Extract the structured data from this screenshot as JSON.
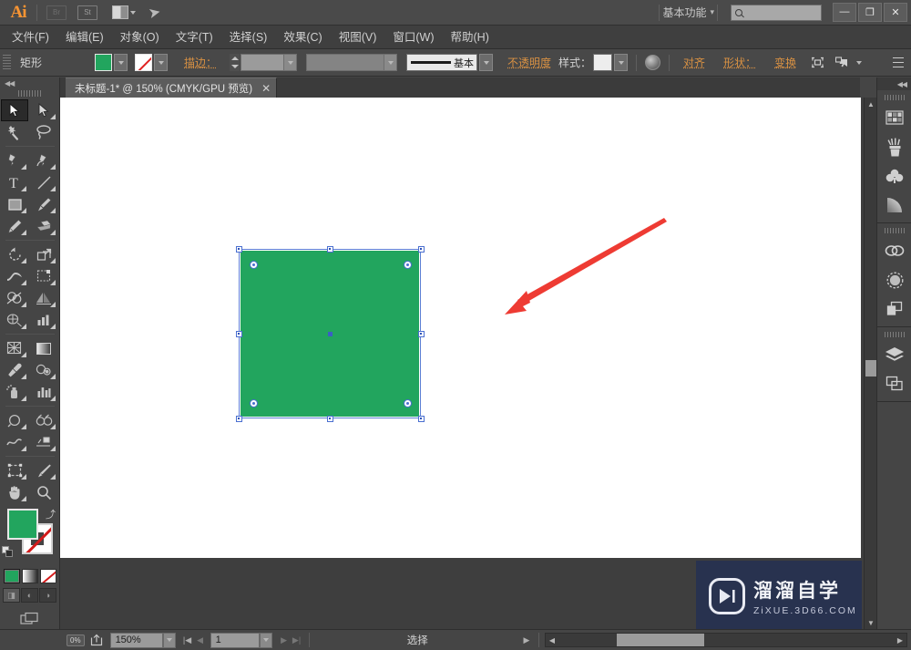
{
  "app": {
    "name": "Adobe Illustrator",
    "logo_text": "Ai",
    "bridge_label": "Br",
    "stock_label": "St"
  },
  "titlebar": {
    "workspace_label": "基本功能",
    "workspace_caret": "▾",
    "search_placeholder": "",
    "search_icon": "search-icon",
    "minimize": "—",
    "restore": "❐",
    "close": "✕"
  },
  "menubar": {
    "items": [
      {
        "label": "文件(F)"
      },
      {
        "label": "编辑(E)"
      },
      {
        "label": "对象(O)"
      },
      {
        "label": "文字(T)"
      },
      {
        "label": "选择(S)"
      },
      {
        "label": "效果(C)"
      },
      {
        "label": "视图(V)"
      },
      {
        "label": "窗口(W)"
      },
      {
        "label": "帮助(H)"
      }
    ]
  },
  "controlbar": {
    "tool_name": "矩形",
    "fill_color": "#22a55e",
    "stroke_color": "none",
    "stroke_label": "描边：",
    "stroke_weight": "",
    "stroke_variable_width": "",
    "stroke_profile_label": "基本",
    "opacity_label": "不透明度",
    "style_label": "样式：",
    "align_label": "对齐",
    "shape_label": "形状：",
    "transform_label": "变换",
    "recolor_icon": "recolor-artwork-icon",
    "isolate_icon": "isolate-selected-icon",
    "select_similar_icon": "select-similar-objects-icon",
    "panel_menu_icon": "panel-options-icon"
  },
  "tabbar": {
    "document_title": "未标题-1* @ 150% (CMYK/GPU 预览)",
    "close_label": "✕"
  },
  "toolbar": {
    "collapse_icon": "collapse-panel-icon",
    "tools": [
      {
        "name": "selection-tool",
        "label": "选择工具",
        "active": true
      },
      {
        "name": "direct-selection-tool",
        "label": "直接选择工具",
        "active": false
      },
      {
        "name": "magic-wand-tool",
        "label": "魔棒工具",
        "active": false
      },
      {
        "name": "lasso-tool",
        "label": "套索工具",
        "active": false
      },
      {
        "name": "pen-tool",
        "label": "钢笔工具",
        "active": false
      },
      {
        "name": "curvature-tool",
        "label": "曲率工具",
        "active": false
      },
      {
        "name": "type-tool",
        "label": "文字工具",
        "active": false
      },
      {
        "name": "line-segment-tool",
        "label": "直线段工具",
        "active": false
      },
      {
        "name": "rectangle-tool",
        "label": "矩形工具",
        "active": false
      },
      {
        "name": "paintbrush-tool",
        "label": "画笔工具",
        "active": false
      },
      {
        "name": "pencil-tool",
        "label": "铅笔工具",
        "active": false
      },
      {
        "name": "eraser-tool",
        "label": "橡皮擦工具",
        "active": false
      },
      {
        "name": "rotate-tool",
        "label": "旋转工具",
        "active": false
      },
      {
        "name": "scale-tool",
        "label": "比例缩放工具",
        "active": false
      },
      {
        "name": "width-tool",
        "label": "宽度工具",
        "active": false
      },
      {
        "name": "free-transform-tool",
        "label": "自由变换工具",
        "active": false
      },
      {
        "name": "shape-builder-tool",
        "label": "形状生成器工具",
        "active": false
      },
      {
        "name": "perspective-grid-tool",
        "label": "透视网格工具",
        "active": false
      },
      {
        "name": "mesh-tool",
        "label": "网格工具",
        "active": false
      },
      {
        "name": "gradient-tool",
        "label": "渐变工具",
        "active": false
      },
      {
        "name": "eyedropper-tool",
        "label": "吸管工具",
        "active": false
      },
      {
        "name": "blend-tool",
        "label": "混合工具",
        "active": false
      },
      {
        "name": "symbol-sprayer-tool",
        "label": "符号喷枪工具",
        "active": false
      },
      {
        "name": "column-graph-tool",
        "label": "柱形图工具",
        "active": false
      },
      {
        "name": "artboard-tool",
        "label": "画板工具",
        "active": false
      },
      {
        "name": "slice-tool",
        "label": "切片工具",
        "active": false
      },
      {
        "name": "hand-tool",
        "label": "抓手工具",
        "active": false
      },
      {
        "name": "zoom-tool",
        "label": "缩放工具",
        "active": false
      }
    ],
    "fill_color": "#22a55e",
    "stroke_color": "none",
    "swap_icon": "swap-fill-stroke-icon",
    "default_icon": "default-fill-stroke-icon",
    "color_modes": [
      {
        "name": "color-mode-button",
        "type": "solid",
        "selected": true
      },
      {
        "name": "gradient-mode-button",
        "type": "gradient",
        "selected": false
      },
      {
        "name": "none-mode-button",
        "type": "none",
        "selected": false
      }
    ],
    "draw_modes": [
      {
        "name": "draw-normal-button",
        "selected": true
      },
      {
        "name": "draw-behind-button",
        "selected": false
      },
      {
        "name": "draw-inside-button",
        "selected": false
      }
    ],
    "screen_mode_icon": "change-screen-mode-icon"
  },
  "rightpanel": {
    "collapse_icon": "expand-panels-icon",
    "groups": [
      {
        "icons": [
          {
            "name": "color-panel-icon"
          },
          {
            "name": "brushes-panel-icon"
          },
          {
            "name": "symbols-panel-icon"
          },
          {
            "name": "gradient-panel-icon"
          }
        ]
      },
      {
        "icons": [
          {
            "name": "links-panel-icon"
          },
          {
            "name": "transparency-panel-icon"
          },
          {
            "name": "pathfinder-panel-icon"
          }
        ]
      },
      {
        "icons": [
          {
            "name": "layers-panel-icon"
          },
          {
            "name": "artboards-panel-icon"
          }
        ]
      }
    ]
  },
  "canvas": {
    "artboard_background": "#ffffff",
    "shape": {
      "name": "green-rectangle",
      "fill": "#22a55e",
      "selected": true,
      "handles": 8,
      "corner_widgets": 4,
      "handle_color": "#4a6fd0"
    },
    "annotation": {
      "name": "red-arrow-annotation",
      "color": "#ee3b33",
      "direction": "down-left"
    }
  },
  "watermark": {
    "title": "溜溜自学",
    "url": "ZiXUE.3D66.COM",
    "background": "#28324f",
    "play_icon": "play-button-icon"
  },
  "statusbar": {
    "artboard_nav_icon": "artboard-navigation-icon",
    "share_icon": "share-document-icon",
    "zoom_level": "150%",
    "page_number": "1",
    "first_label": "|◀",
    "prev_label": "◀",
    "next_label": "▶",
    "last_label": "▶|",
    "status_text": "选择",
    "status_caret": "▶"
  },
  "scrollbars": {
    "vertical_up": "▲",
    "vertical_down": "▼",
    "horizontal_left": "◀",
    "horizontal_right": "▶"
  }
}
